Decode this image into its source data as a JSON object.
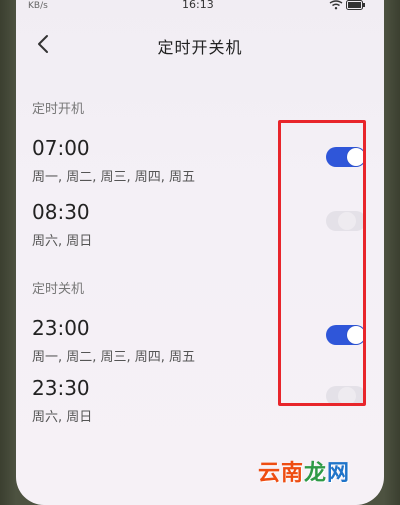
{
  "status_bar": {
    "carrier": "KB/s",
    "time": "16:13",
    "icons": "wifi-icon battery-icon"
  },
  "header": {
    "back_icon": "chevron-left-icon",
    "title": "定时开关机"
  },
  "power_on": {
    "section_title": "定时开机",
    "items": [
      {
        "time": "07:00",
        "days": "周一, 周二, 周三, 周四, 周五",
        "enabled": true
      },
      {
        "time": "08:30",
        "days": "周六, 周日",
        "enabled": false
      }
    ]
  },
  "power_off": {
    "section_title": "定时关机",
    "items": [
      {
        "time": "23:00",
        "days": "周一, 周二, 周三, 周四, 周五",
        "enabled": true
      },
      {
        "time": "23:30",
        "days": "周六, 周日",
        "enabled": false
      }
    ]
  },
  "colors": {
    "toggle_on": "#2f56d9",
    "highlight": "#e8252b"
  },
  "watermark": {
    "part1": "云南",
    "part2": "龙",
    "part3": "网"
  }
}
